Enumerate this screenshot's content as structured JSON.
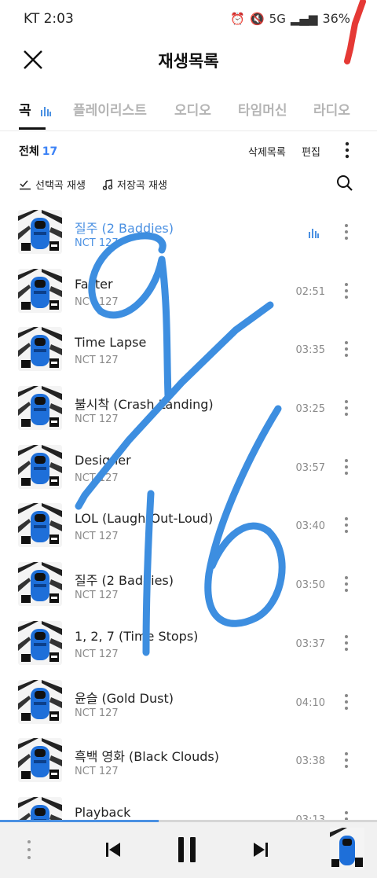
{
  "status_bar": {
    "time": "KT 2:03",
    "battery": "36%",
    "network": "5G"
  },
  "header": {
    "title": "재생목록"
  },
  "tabs": [
    {
      "label": "곡",
      "active": true
    },
    {
      "label": "플레이리스트",
      "active": false
    },
    {
      "label": "오디오",
      "active": false
    },
    {
      "label": "타임머신",
      "active": false
    },
    {
      "label": "라디오",
      "active": false
    }
  ],
  "summary": {
    "total_label": "전체",
    "count": "17",
    "delete_list": "삭제목록",
    "edit": "편집"
  },
  "actions": {
    "play_selected": "선택곡 재생",
    "play_saved": "저장곡 재생"
  },
  "songs": [
    {
      "title": "질주 (2 Baddies)",
      "artist": "NCT 127",
      "duration": "",
      "playing": true
    },
    {
      "title": "Faster",
      "artist": "NCT 127",
      "duration": "02:51",
      "playing": false
    },
    {
      "title": "Time Lapse",
      "artist": "NCT 127",
      "duration": "03:35",
      "playing": false
    },
    {
      "title": "불시착 (Crash Landing)",
      "artist": "NCT 127",
      "duration": "03:25",
      "playing": false
    },
    {
      "title": "Designer",
      "artist": "NCT 127",
      "duration": "03:57",
      "playing": false
    },
    {
      "title": "LOL (Laugh-Out-Loud)",
      "artist": "NCT 127",
      "duration": "03:40",
      "playing": false
    },
    {
      "title": "질주 (2 Baddies)",
      "artist": "NCT 127",
      "duration": "03:50",
      "playing": false
    },
    {
      "title": "1, 2, 7 (Time Stops)",
      "artist": "NCT 127",
      "duration": "03:37",
      "playing": false
    },
    {
      "title": "윤슬 (Gold Dust)",
      "artist": "NCT 127",
      "duration": "04:10",
      "playing": false
    },
    {
      "title": "흑백 영화 (Black Clouds)",
      "artist": "NCT 127",
      "duration": "03:38",
      "playing": false
    },
    {
      "title": "Playback",
      "artist": "NCT 127",
      "duration": "03:13",
      "playing": false
    }
  ],
  "player": {
    "progress": 0.42
  },
  "colors": {
    "accent": "#4a90e2",
    "count": "#3b82f6",
    "scribble": "#3d8ee0",
    "red_mark": "#e53935"
  }
}
